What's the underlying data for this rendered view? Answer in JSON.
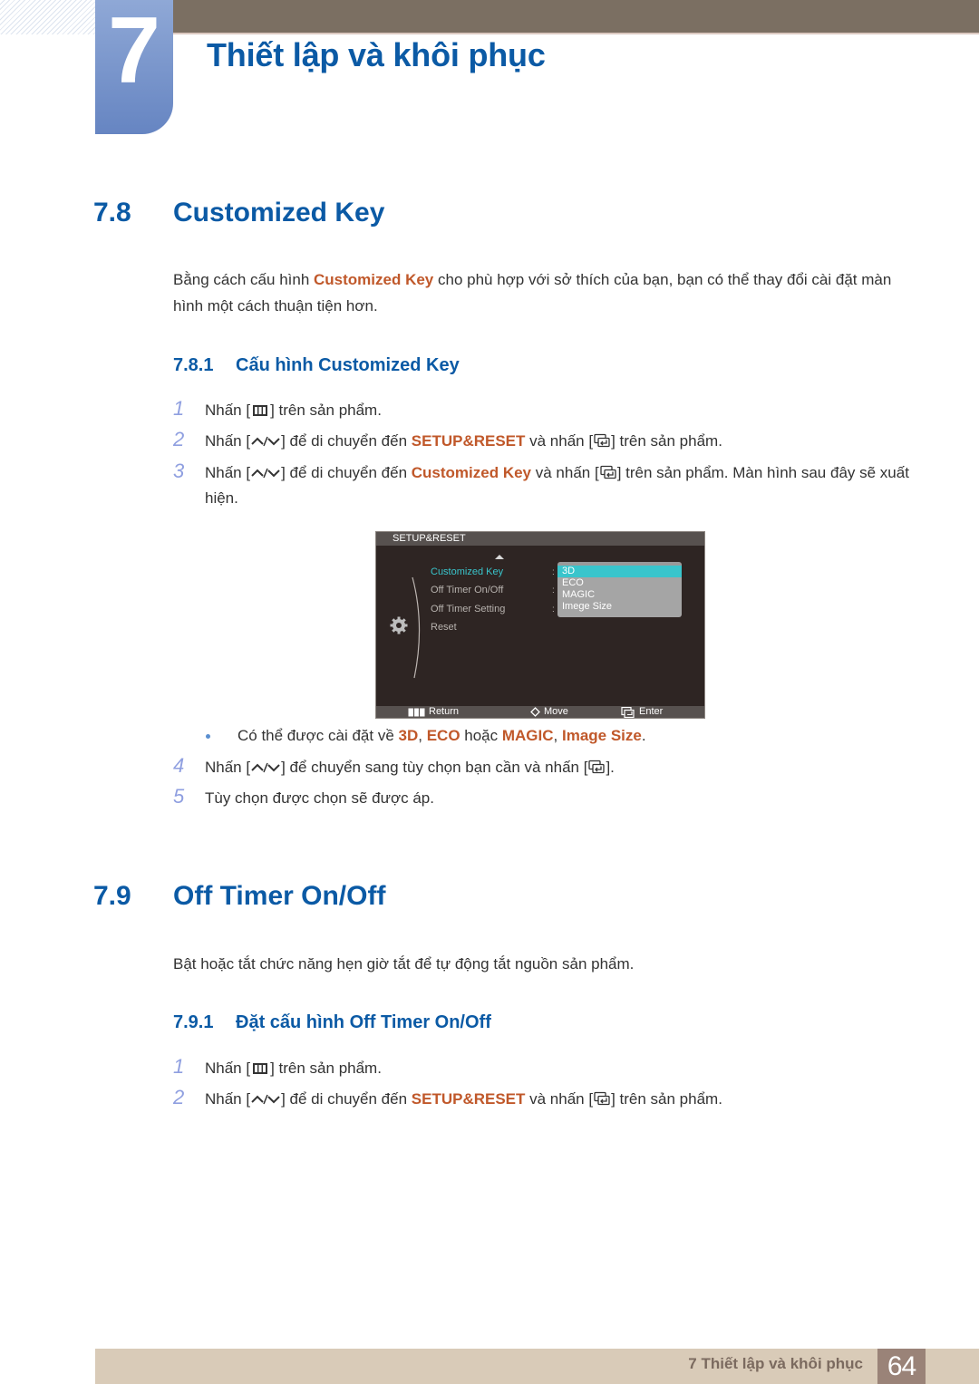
{
  "header": {
    "chapter_number": "7",
    "chapter_title": "Thiết lập và khôi phục"
  },
  "colors": {
    "heading_blue": "#0b5aa5",
    "highlight_orange": "#c0582a",
    "step_number": "#8f9fe0",
    "top_bar": "#7b6f62",
    "footer_bar": "#d9cbb8",
    "footer_page_bg": "#9a8378",
    "osd_accent": "#39c5cc"
  },
  "section_78": {
    "number": "7.8",
    "title": "Customized Key",
    "intro": {
      "before": "Bằng cách cấu hình ",
      "highlight": "Customized Key",
      "after": " cho phù hợp với sở thích của bạn, bạn có thể thay đổi cài đặt màn hình một cách thuận tiện hơn."
    },
    "subsection": {
      "number": "7.8.1",
      "title": "Cấu hình Customized Key"
    },
    "steps": [
      {
        "n": "1",
        "pre": "Nhấn [",
        "icon": "menu-key-icon",
        "post": "] trên sản phẩm."
      },
      {
        "n": "2",
        "pre": "Nhấn [",
        "icon": "up-down-key-icon",
        "mid": "] để di chuyển đến ",
        "highlight": "SETUP&RESET",
        "mid2": " và nhấn [",
        "icon2": "enter-key-icon",
        "post": "] trên sản phẩm."
      },
      {
        "n": "3",
        "pre": "Nhấn [",
        "icon": "up-down-key-icon",
        "mid": "] để di chuyển đến ",
        "highlight": "Customized Key",
        "mid2": " và nhấn [",
        "icon2": "enter-key-icon",
        "post": "] trên sản phẩm. Màn hình sau đây sẽ xuất hiện."
      },
      {
        "n": "4",
        "pre": "Nhấn [",
        "icon": "up-down-key-icon",
        "mid": "] để chuyển sang tùy chọn bạn cần và nhấn [",
        "icon2": "enter-key-icon",
        "post": "]."
      },
      {
        "n": "5",
        "text": "Tùy chọn được chọn sẽ được áp."
      }
    ],
    "bullet": {
      "pre": "Có thể được cài đặt về ",
      "opt1": "3D",
      "sep1": ", ",
      "opt2": "ECO",
      "sep2": " hoặc ",
      "opt3": "MAGIC",
      "sep3": ", ",
      "opt4": "Image Size",
      "end": "."
    },
    "osd": {
      "title": "SETUP&RESET",
      "menu_items": [
        "Customized Key",
        "Off Timer On/Off",
        "Off Timer Setting",
        "Reset"
      ],
      "active_item": "Customized Key",
      "dropdown_options": [
        "3D",
        "ECO",
        "MAGIC",
        "Imege Size"
      ],
      "selected_option": "3D",
      "footer": {
        "return": "Return",
        "move": "Move",
        "enter": "Enter"
      }
    }
  },
  "section_79": {
    "number": "7.9",
    "title": "Off Timer On/Off",
    "intro": "Bật hoặc tắt chức năng hẹn giờ tắt để tự động tắt nguồn sản phẩm.",
    "subsection": {
      "number": "7.9.1",
      "title": "Đặt cấu hình Off Timer On/Off"
    },
    "steps": [
      {
        "n": "1",
        "pre": "Nhấn [",
        "icon": "menu-key-icon",
        "post": "] trên sản phẩm."
      },
      {
        "n": "2",
        "pre": "Nhấn [",
        "icon": "up-down-key-icon",
        "mid": "] để di chuyển đến ",
        "highlight": "SETUP&RESET",
        "mid2": " và nhấn [",
        "icon2": "enter-key-icon",
        "post": "] trên sản phẩm."
      }
    ]
  },
  "footer": {
    "chapter_label": "7 Thiết lập và khôi phục",
    "page_number": "64"
  }
}
